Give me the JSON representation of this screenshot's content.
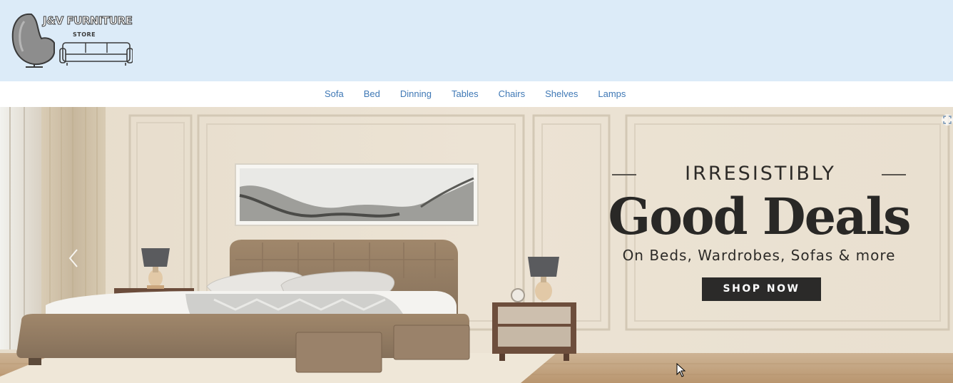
{
  "brand": {
    "title": "J&V FURNITURE",
    "subtitle": "STORE",
    "logo_icon": "armchair-and-sofa-icon"
  },
  "nav": {
    "items": [
      {
        "label": "Sofa"
      },
      {
        "label": "Bed"
      },
      {
        "label": "Dinning"
      },
      {
        "label": "Tables"
      },
      {
        "label": "Chairs"
      },
      {
        "label": "Shelves"
      },
      {
        "label": "Lamps"
      }
    ]
  },
  "hero": {
    "eyebrow": "IRRESISTIBLY",
    "headline": "Good Deals",
    "subline": "On Beds, Wardrobes, Sofas & more",
    "cta_label": "SHOP NOW",
    "prev_icon": "chevron-left-icon",
    "corner_icon": "scan-icon"
  },
  "colors": {
    "header_bg": "#dcebf8",
    "nav_link": "#3f78b5",
    "cta_bg": "#2b2a29",
    "headline": "#292826"
  }
}
